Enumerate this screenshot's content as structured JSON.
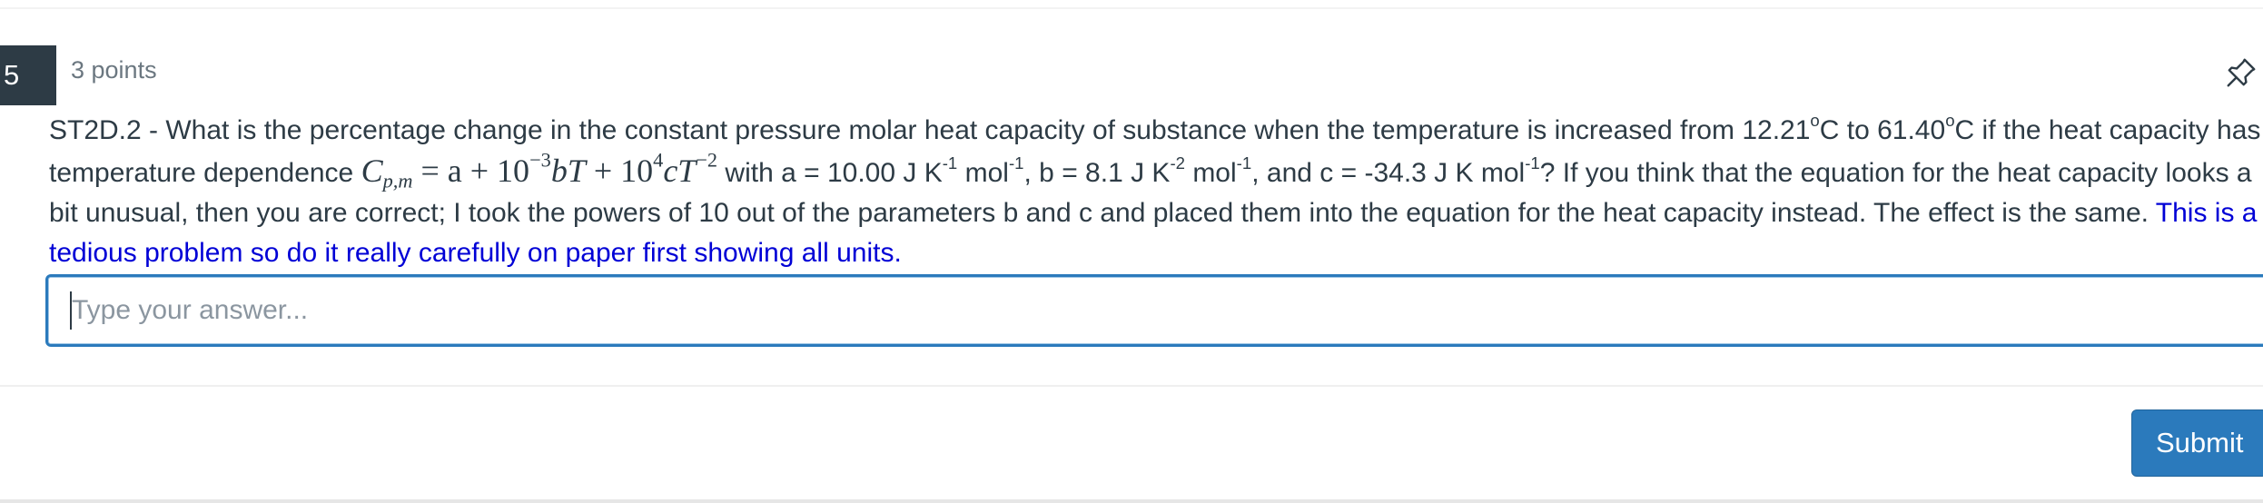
{
  "question": {
    "number": "5",
    "points": "3 points",
    "text": {
      "intro": "ST2D.2 - What is the percentage change in the constant pressure molar heat capacity of substance when the temperature is increased from 12.21",
      "deg_sup_1": "o",
      "t1_unit": "C to 61.40",
      "deg_sup_2": "o",
      "t2_unit": "C if the heat capacity has temperature dependence ",
      "eq_C": "C",
      "eq_sub": "p,m",
      "eq_mid": " = a + 10",
      "eq_exp1": "−3",
      "eq_bT": "bT",
      "eq_plus": " + 10",
      "eq_exp2": "4",
      "eq_cT": "cT",
      "eq_exp3": "−2",
      "with_a": " with a = 10.00 J K",
      "a_sup1": "-1",
      "a_mol": " mol",
      "a_sup2": "-1",
      "b_part": ", b = 8.1 J K",
      "b_sup1": "-2",
      "b_mol": " mol",
      "b_sup2": "-1",
      "c_part": ", and c = -34.3 J K mol",
      "c_sup": "-1",
      "rest": "? If you think that the equation for the heat capacity looks a bit unusual, then you are correct; I took the powers of 10 out of the parameters b and c and placed them into the equation for the heat capacity instead.  The effect is the same.  ",
      "note": "This is a tedious problem so do it really carefully on paper first showing all units."
    }
  },
  "answer": {
    "placeholder": "Type your answer...",
    "value": ""
  },
  "submit_label": "Submit",
  "icons": {
    "pin": "pin-icon"
  },
  "colors": {
    "accent": "#2b7abc",
    "number_badge": "#2d3b45",
    "note_text": "#0000d6",
    "body_text": "#2d3b45"
  }
}
